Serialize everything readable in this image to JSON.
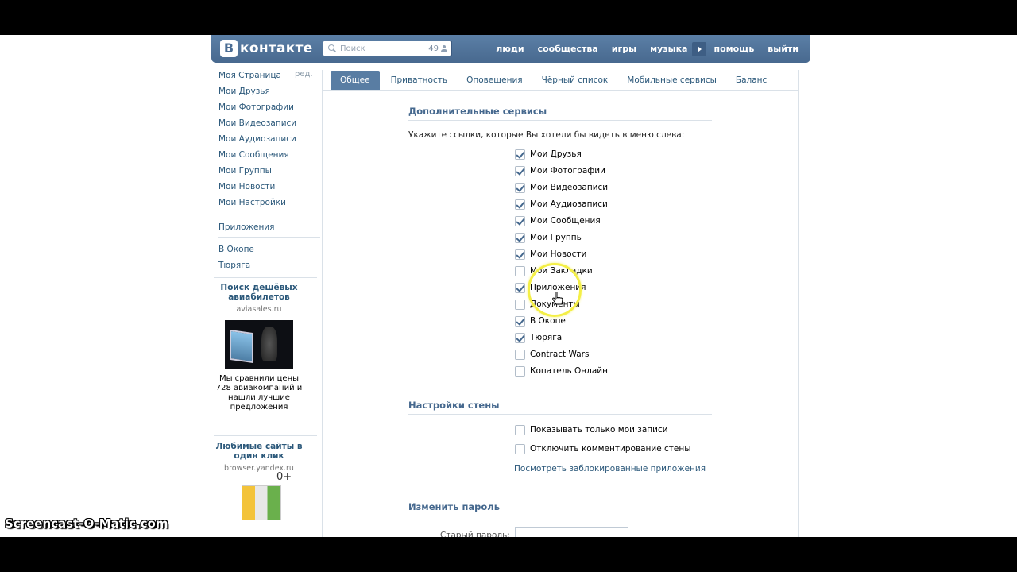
{
  "header": {
    "logo_letter": "В",
    "logo_text": "контакте",
    "search_placeholder": "Поиск",
    "search_count": "49",
    "nav": [
      "люди",
      "сообщества",
      "игры",
      "музыка",
      "помощь",
      "выйти"
    ]
  },
  "sidebar": {
    "items": [
      "Моя Страница",
      "Мои Друзья",
      "Мои Фотографии",
      "Мои Видеозаписи",
      "Мои Аудиозаписи",
      "Мои Сообщения",
      "Мои Группы",
      "Мои Новости",
      "Мои Настройки"
    ],
    "edit_label": "ред.",
    "apps_label": "Приложения",
    "app_links": [
      "В Окопе",
      "Тюряга"
    ]
  },
  "ads": {
    "ad1": {
      "title": "Поиск дешёвых авиабилетов",
      "domain": "aviasales.ru",
      "text": "Мы сравнили цены 728 авиакомпаний и нашли лучшие предложения"
    },
    "ad2": {
      "title": "Любимые сайты в один клик",
      "domain": "browser.yandex.ru",
      "badge": "0+"
    }
  },
  "tabs": [
    "Общее",
    "Приватность",
    "Оповещения",
    "Чёрный список",
    "Мобильные сервисы",
    "Баланс"
  ],
  "services": {
    "title": "Дополнительные сервисы",
    "hint": "Укажите ссылки, которые Вы хотели бы видеть в меню слева:",
    "options": [
      {
        "label": "Мои Друзья",
        "checked": true
      },
      {
        "label": "Мои Фотографии",
        "checked": true
      },
      {
        "label": "Мои Видеозаписи",
        "checked": true
      },
      {
        "label": "Мои Аудиозаписи",
        "checked": true
      },
      {
        "label": "Мои Сообщения",
        "checked": true
      },
      {
        "label": "Мои Группы",
        "checked": true
      },
      {
        "label": "Мои Новости",
        "checked": true
      },
      {
        "label": "Мои Закладки",
        "checked": false
      },
      {
        "label": "Приложения",
        "checked": true
      },
      {
        "label": "Документы",
        "checked": false
      },
      {
        "label": "В Окопе",
        "checked": true
      },
      {
        "label": "Тюряга",
        "checked": true
      },
      {
        "label": "Contract Wars",
        "checked": false
      },
      {
        "label": "Копатель Онлайн",
        "checked": false
      }
    ]
  },
  "wall": {
    "title": "Настройки стены",
    "options": [
      {
        "label": "Показывать только мои записи",
        "checked": false
      },
      {
        "label": "Отключить комментирование стены",
        "checked": false
      }
    ],
    "blocked_link": "Посмотреть заблокированные приложения"
  },
  "password": {
    "title": "Изменить пароль",
    "old_label": "Старый пароль:",
    "old_value": ""
  },
  "watermark": "Screencast-O-Matic.com",
  "colors": {
    "header": "#54769b",
    "link": "#2b587a",
    "active_tab": "#597da3",
    "highlight": "#f4ef46"
  }
}
